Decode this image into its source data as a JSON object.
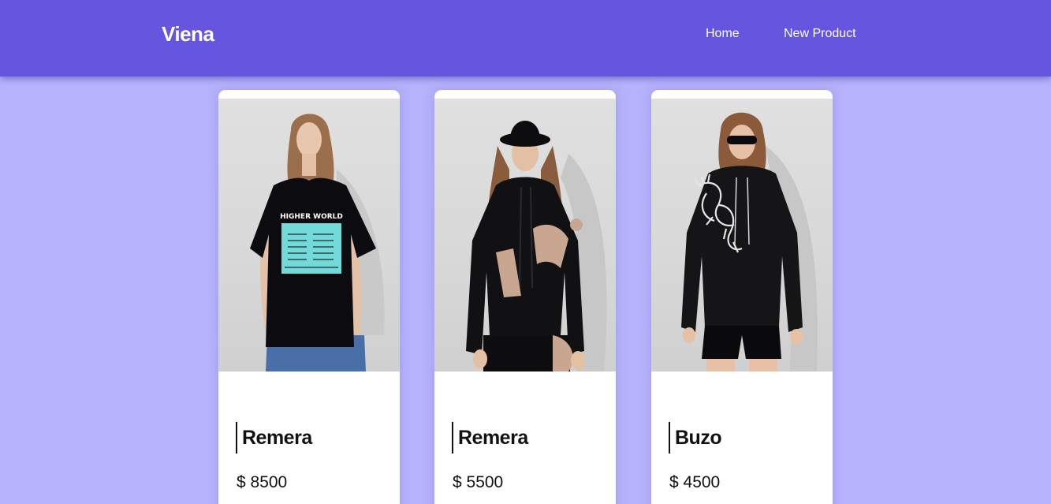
{
  "app": {
    "brand": "Viena"
  },
  "nav": {
    "links": [
      "Home",
      "New Product"
    ]
  },
  "products": [
    {
      "name": "Remera",
      "price": "$ 8500",
      "image_alt": "Black t-shirt with turquoise print",
      "print_text": "HIGHER WORLD"
    },
    {
      "name": "Remera",
      "price": "$ 5500",
      "image_alt": "Black hoodie with beige print and bucket hat"
    },
    {
      "name": "Buzo",
      "price": "$ 4500",
      "image_alt": "Black hoodie with white dragon print"
    }
  ],
  "colors": {
    "navbar": "#6655de",
    "background": "#b6b3fc",
    "card": "#ffffff"
  }
}
